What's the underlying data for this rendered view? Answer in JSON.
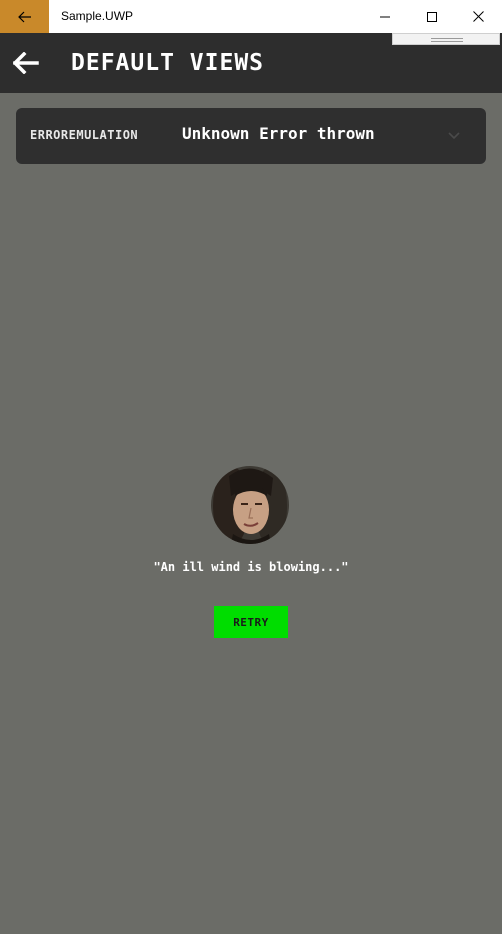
{
  "window": {
    "title": "Sample.UWP",
    "accent_color": "#c9892a",
    "back_icon": "arrow-left-icon",
    "minimize_icon": "minimize-icon",
    "maximize_icon": "maximize-icon",
    "close_icon": "close-icon"
  },
  "header": {
    "title": "DEFAULT VIEWS",
    "back_icon": "arrow-left-icon",
    "background": "#2d2d2d"
  },
  "error_emulation": {
    "label": "ERROREMULATION",
    "selected_value": "Unknown Error thrown",
    "chevron_icon": "chevron-down-icon"
  },
  "error_view": {
    "avatar": "avatar-portrait",
    "message": "\"An ill wind is blowing...\"",
    "retry_label": "RETRY",
    "retry_color": "#00dd00"
  },
  "page": {
    "background": "#6b6c67"
  }
}
